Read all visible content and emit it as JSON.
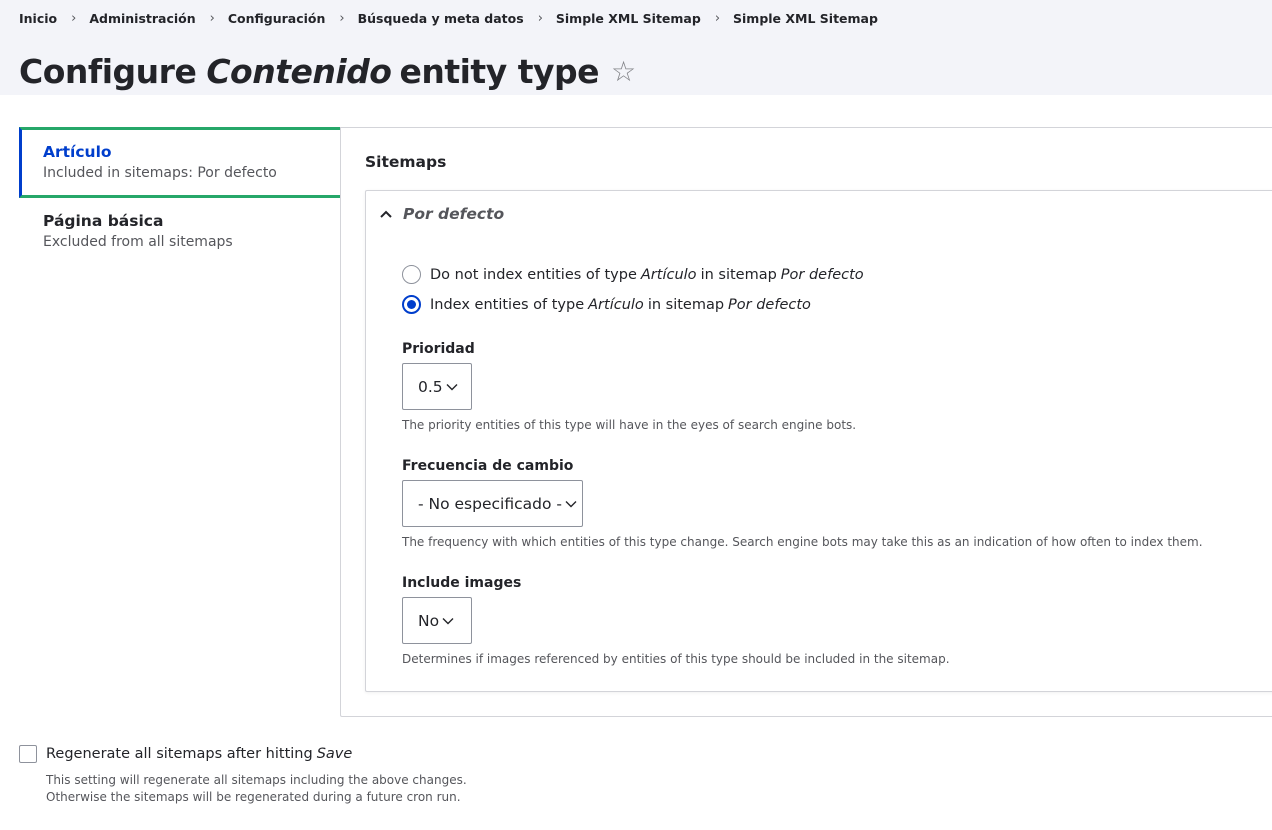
{
  "breadcrumb": [
    {
      "label": "Inicio"
    },
    {
      "label": "Administración"
    },
    {
      "label": "Configuración"
    },
    {
      "label": "Búsqueda y meta datos"
    },
    {
      "label": "Simple XML Sitemap"
    },
    {
      "label": "Simple XML Sitemap"
    }
  ],
  "breadcrumb_separator": "›",
  "title": {
    "prefix": "Configure",
    "entity": "Contenido",
    "suffix": "entity type",
    "star_icon": "star-outline-icon",
    "star_glyph": "☆"
  },
  "tabs": [
    {
      "title": "Artículo",
      "summary": "Included in sitemaps: Por defecto",
      "active": true
    },
    {
      "title": "Página básica",
      "summary": "Excluded from all sitemaps",
      "active": false
    }
  ],
  "sitemaps": {
    "legend": "Sitemaps",
    "details_summary": "Por defecto",
    "radio_no": {
      "pre": "Do not index entities of type",
      "type": "Artículo",
      "mid": "in sitemap",
      "sitemap": "Por defecto",
      "checked": false
    },
    "radio_yes": {
      "pre": "Index entities of type",
      "type": "Artículo",
      "mid": "in sitemap",
      "sitemap": "Por defecto",
      "checked": true
    },
    "priority": {
      "label": "Prioridad",
      "value": "0.5",
      "description": "The priority entities of this type will have in the eyes of search engine bots."
    },
    "changefreq": {
      "label": "Frecuencia de cambio",
      "value": "- No especificado -",
      "description": "The frequency with which entities of this type change. Search engine bots may take this as an indication of how often to index them."
    },
    "images": {
      "label": "Include images",
      "value": "No",
      "description": "Determines if images referenced by entities of this type should be included in the sitemap."
    }
  },
  "regenerate": {
    "label": "Regenerate all sitemaps after hitting",
    "label_em": "Save",
    "checked": false,
    "description_line1": "This setting will regenerate all sitemaps including the above changes.",
    "description_line2": "Otherwise the sitemaps will be regenerated during a future cron run."
  },
  "colors": {
    "accent": "#003ecc",
    "tab_border": "#26a769",
    "header_bg": "#f3f4f9",
    "text": "#232429",
    "muted": "#55565b"
  }
}
